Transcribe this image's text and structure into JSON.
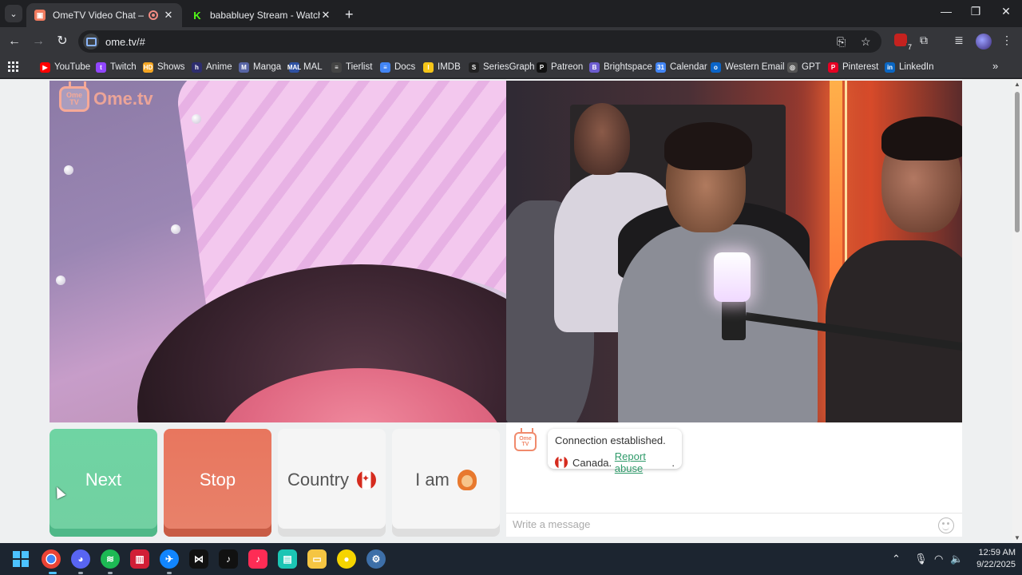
{
  "browser": {
    "tabs": [
      {
        "title": "OmeTV Video Chat — Ome",
        "active": true,
        "icon": "ometv-favicon"
      },
      {
        "title": "bababluey Stream - Watch Live",
        "active": false,
        "icon": "kick-favicon"
      }
    ],
    "close_symbol": "✕",
    "new_tab_symbol": "+",
    "url": "ome.tv/#",
    "window_controls": {
      "minimize": "—",
      "maximize": "❐",
      "close": "✕"
    },
    "extension_badge_count": "7",
    "bookmarks": [
      {
        "label": "YouTube",
        "color": "#ff0000",
        "glyph": "▶"
      },
      {
        "label": "Twitch",
        "color": "#9146ff",
        "glyph": "t"
      },
      {
        "label": "Shows",
        "color": "#f5a623",
        "glyph": "HD"
      },
      {
        "label": "Anime",
        "color": "#2d2d6e",
        "glyph": "h"
      },
      {
        "label": "Manga",
        "color": "#5865a5",
        "glyph": "M"
      },
      {
        "label": "MAL",
        "color": "#2e51a2",
        "glyph": "MAL"
      },
      {
        "label": "Tierlist",
        "color": "#444444",
        "glyph": "≡"
      },
      {
        "label": "Docs",
        "color": "#4285f4",
        "glyph": "≡"
      },
      {
        "label": "IMDB",
        "color": "#f5c518",
        "glyph": "I"
      },
      {
        "label": "SeriesGraph",
        "color": "#222222",
        "glyph": "S"
      },
      {
        "label": "Patreon",
        "color": "#111111",
        "glyph": "P"
      },
      {
        "label": "Brightspace",
        "color": "#6c5ccf",
        "glyph": "B"
      },
      {
        "label": "Calendar",
        "color": "#4285f4",
        "glyph": "31"
      },
      {
        "label": "Western Email",
        "color": "#0a64c8",
        "glyph": "o"
      },
      {
        "label": "GPT",
        "color": "#555555",
        "glyph": "◎"
      },
      {
        "label": "Pinterest",
        "color": "#e60023",
        "glyph": "P"
      },
      {
        "label": "LinkedIn",
        "color": "#0a66c2",
        "glyph": "in"
      }
    ]
  },
  "page": {
    "logo_text": "Ome.tv",
    "logo_tv_text": "Ome TV",
    "buttons": {
      "next": "Next",
      "stop": "Stop",
      "country": "Country",
      "i_am": "I am"
    },
    "chat": {
      "status": "Connection established.",
      "country": "Canada.",
      "report_link": "Report abuse",
      "trailing": ".",
      "input_placeholder": "Write a message"
    },
    "colors": {
      "next": "#6fd4a3",
      "stop": "#e8765e",
      "brand": "#f6a997",
      "link": "#2f9a6a"
    }
  },
  "taskbar": {
    "apps": [
      "windows-start",
      "chrome",
      "discord",
      "spotify",
      "app-red",
      "bluesky",
      "capcut",
      "tiktok",
      "tiktok-pink",
      "teal-app",
      "file-explorer",
      "yellow-circle",
      "settings"
    ],
    "time": "12:59 AM",
    "date": "9/22/2025"
  }
}
